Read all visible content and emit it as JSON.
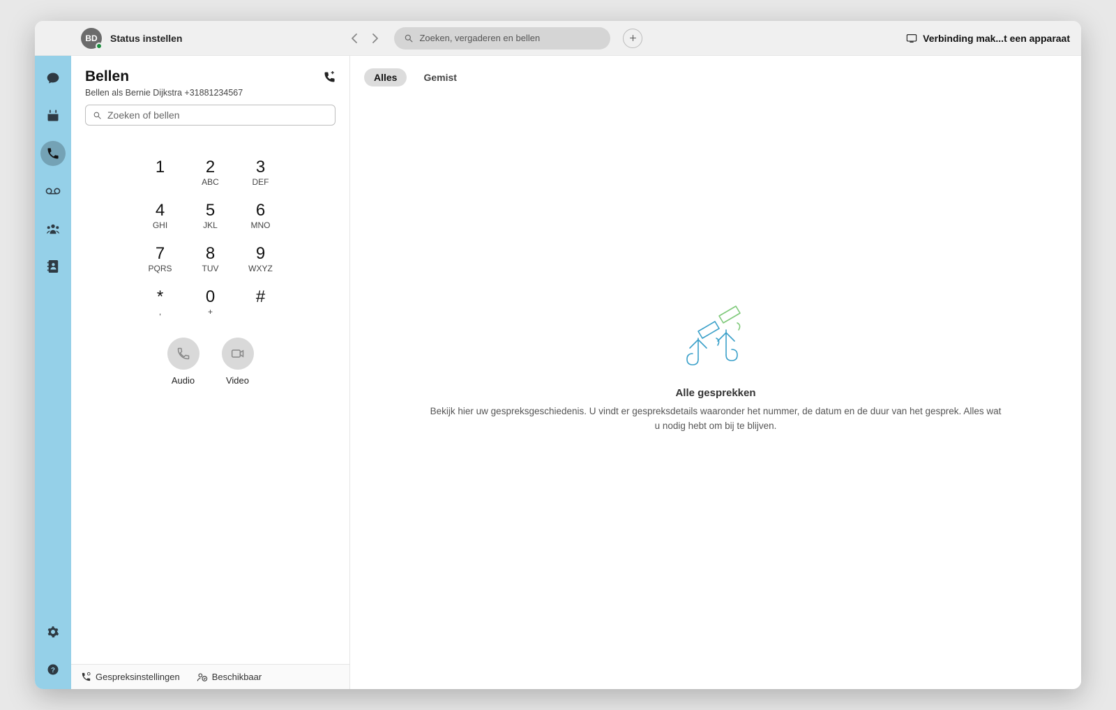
{
  "titlebar": {
    "avatar_initials": "BD",
    "status_label": "Status instellen",
    "search_placeholder": "Zoeken, vergaderen en bellen",
    "device_label": "Verbinding mak...t een apparaat"
  },
  "panel": {
    "title": "Bellen",
    "subtitle": "Bellen als Bernie Dijkstra +31881234567",
    "search_placeholder": "Zoeken of bellen",
    "dialpad": [
      {
        "digit": "1",
        "letters": ""
      },
      {
        "digit": "2",
        "letters": "ABC"
      },
      {
        "digit": "3",
        "letters": "DEF"
      },
      {
        "digit": "4",
        "letters": "GHI"
      },
      {
        "digit": "5",
        "letters": "JKL"
      },
      {
        "digit": "6",
        "letters": "MNO"
      },
      {
        "digit": "7",
        "letters": "PQRS"
      },
      {
        "digit": "8",
        "letters": "TUV"
      },
      {
        "digit": "9",
        "letters": "WXYZ"
      },
      {
        "digit": "*",
        "letters": ","
      },
      {
        "digit": "0",
        "letters": "+"
      },
      {
        "digit": "#",
        "letters": ""
      }
    ],
    "audio_label": "Audio",
    "video_label": "Video",
    "footer_settings": "Gespreksinstellingen",
    "footer_availability": "Beschikbaar"
  },
  "tabs": {
    "all": "Alles",
    "missed": "Gemist"
  },
  "empty": {
    "title": "Alle gesprekken",
    "body": "Bekijk hier uw gespreksgeschiedenis. U vindt er gespreksdetails waaronder het nummer, de datum en de duur van het gesprek. Alles wat u nodig hebt om bij te blijven."
  }
}
